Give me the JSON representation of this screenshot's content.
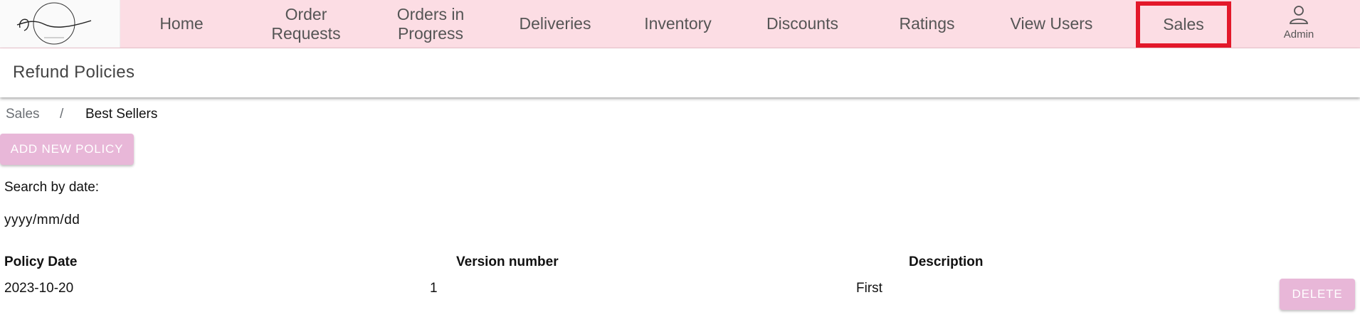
{
  "nav": {
    "home": "Home",
    "order_requests_line1": "Order",
    "order_requests_line2": "Requests",
    "orders_in_progress_line1": "Orders in",
    "orders_in_progress_line2": "Progress",
    "deliveries": "Deliveries",
    "inventory": "Inventory",
    "discounts": "Discounts",
    "ratings": "Ratings",
    "view_users": "View Users",
    "sales": "Sales",
    "admin": "Admin",
    "active": "sales",
    "highlight_color": "#e3182a",
    "bar_color": "#fcdde4"
  },
  "logo": {
    "text": "It's Personal",
    "tagline": "EST. 2022"
  },
  "page": {
    "title": "Refund Policies"
  },
  "breadcrumb": {
    "root": "Sales",
    "separator": "/",
    "current": "Best Sellers"
  },
  "actions": {
    "add_new_policy": "ADD NEW POLICY",
    "delete": "DELETE",
    "button_color": "#e8b7d8"
  },
  "search": {
    "label": "Search by date:",
    "placeholder": "yyyy/mm/dd"
  },
  "table": {
    "headers": [
      "Policy Date",
      "Version number",
      "Description"
    ],
    "rows": [
      {
        "policy_date": "2023-10-20",
        "version_number": "1",
        "description": "First"
      }
    ]
  }
}
